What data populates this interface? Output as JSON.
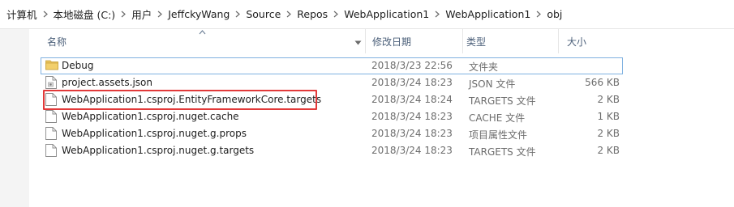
{
  "breadcrumb": [
    "计算机",
    "本地磁盘 (C:)",
    "用户",
    "JeffckyWang",
    "Source",
    "Repos",
    "WebApplication1",
    "WebApplication1",
    "obj"
  ],
  "columns": {
    "name": "名称",
    "date": "修改日期",
    "type": "类型",
    "size": "大小"
  },
  "files": [
    {
      "name": "Debug",
      "date": "2018/3/23 22:56",
      "type": "文件夹",
      "size": "",
      "icon": "folder-icon",
      "selected": true
    },
    {
      "name": "project.assets.json",
      "date": "2018/3/24 18:23",
      "type": "JSON 文件",
      "size": "566 KB",
      "icon": "json-file-icon"
    },
    {
      "name": "WebApplication1.csproj.EntityFrameworkCore.targets",
      "date": "2018/3/24 18:24",
      "type": "TARGETS 文件",
      "size": "2 KB",
      "icon": "file-icon",
      "highlighted": true
    },
    {
      "name": "WebApplication1.csproj.nuget.cache",
      "date": "2018/3/24 18:23",
      "type": "CACHE 文件",
      "size": "1 KB",
      "icon": "file-icon"
    },
    {
      "name": "WebApplication1.csproj.nuget.g.props",
      "date": "2018/3/24 18:23",
      "type": "项目属性文件",
      "size": "2 KB",
      "icon": "file-icon"
    },
    {
      "name": "WebApplication1.csproj.nuget.g.targets",
      "date": "2018/3/24 18:23",
      "type": "TARGETS 文件",
      "size": "2 KB",
      "icon": "file-icon"
    }
  ],
  "colors": {
    "highlight_border": "#e23a3a",
    "selection_border": "#7fb1e0",
    "header_text": "#4c607a",
    "folder": "#e8c15a"
  }
}
